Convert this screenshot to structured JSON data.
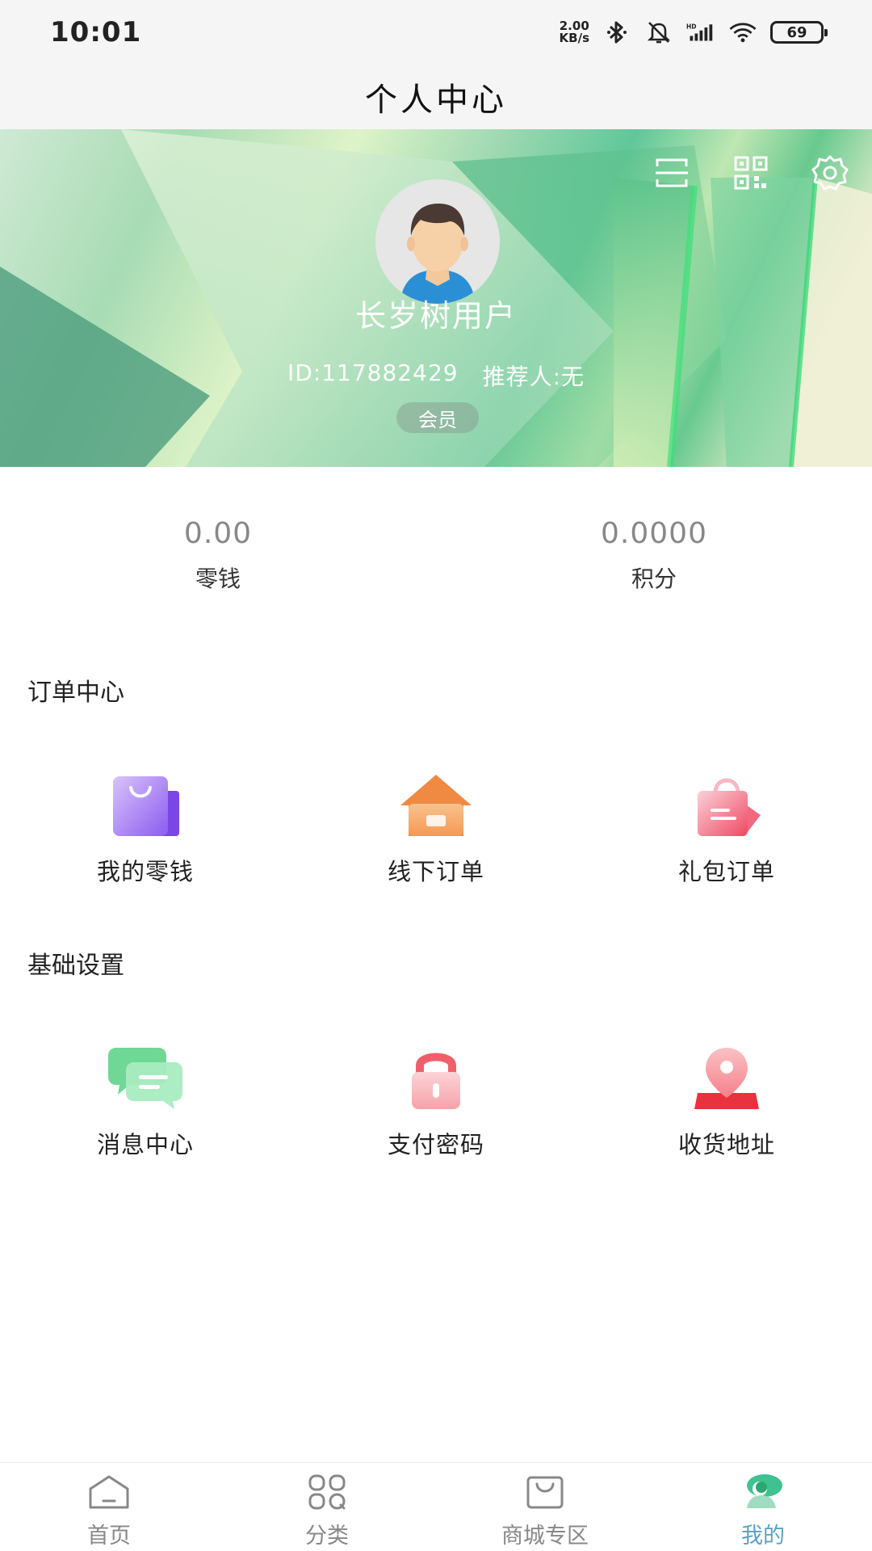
{
  "status_bar": {
    "time": "10:01",
    "speed_value": "2.00",
    "speed_unit": "KB/s",
    "battery": "69",
    "icons": [
      "bluetooth-icon",
      "mute-icon",
      "signal-icon",
      "wifi-icon",
      "battery-icon"
    ]
  },
  "header": {
    "title": "个人中心"
  },
  "profile": {
    "actions": [
      "scan-icon",
      "qr-code-icon",
      "settings-icon"
    ],
    "name": "长岁树用户",
    "id_text": "ID:117882429",
    "referrer_text": "推荐人:无",
    "badge": "会员"
  },
  "stats": [
    {
      "value": "0.00",
      "label": "零钱"
    },
    {
      "value": "0.0000",
      "label": "积分"
    }
  ],
  "orders": {
    "title": "订单中心",
    "items": [
      {
        "label": "我的零钱",
        "icon": "shopping-bag-icon",
        "color": "#9b6cf2"
      },
      {
        "label": "线下订单",
        "icon": "store-icon",
        "color": "#f3a05a"
      },
      {
        "label": "礼包订单",
        "icon": "gift-bag-icon",
        "color": "#f2697f"
      }
    ]
  },
  "settings": {
    "title": "基础设置",
    "items": [
      {
        "label": "消息中心",
        "icon": "chat-icon",
        "color": "#4fcf84"
      },
      {
        "label": "支付密码",
        "icon": "lock-icon",
        "color": "#f4727a"
      },
      {
        "label": "收货地址",
        "icon": "location-icon",
        "color": "#ef4450"
      }
    ]
  },
  "bottom_nav": [
    {
      "label": "首页",
      "icon": "home-icon",
      "active": false
    },
    {
      "label": "分类",
      "icon": "category-icon",
      "active": false
    },
    {
      "label": "商城专区",
      "icon": "mall-bag-icon",
      "active": false
    },
    {
      "label": "我的",
      "icon": "profile-icon",
      "active": true
    }
  ],
  "colors": {
    "accent": "#5aa0c8",
    "active_icon": "#3ec28f",
    "inactive": "#888888"
  }
}
